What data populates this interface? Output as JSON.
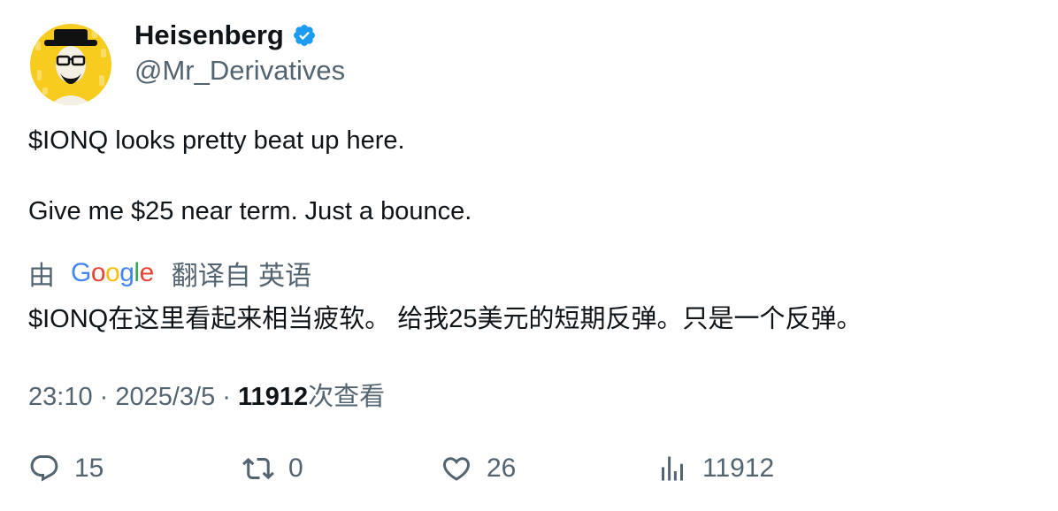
{
  "author": {
    "name": "Heisenberg",
    "handle": "@Mr_Derivatives",
    "verified": true,
    "avatar_icon": "heisenberg-avatar-icon"
  },
  "tweet": {
    "lines": [
      "$IONQ looks pretty beat up here.",
      "Give me $25 near term. Just a bounce."
    ]
  },
  "translation": {
    "prefix": "由",
    "provider_logo": "Google",
    "suffix": "翻译自 英语",
    "text": "$IONQ在这里看起来相当疲软。 给我25美元的短期反弹。只是一个反弹。"
  },
  "meta": {
    "time": "23:10",
    "sep1": " · ",
    "date": "2025/3/5",
    "sep2": " · ",
    "views": "11912",
    "views_label": "次查看"
  },
  "actions": {
    "reply_count": "15",
    "retweet_count": "0",
    "like_count": "26",
    "views_count": "11912"
  },
  "colors": {
    "accent": "#1d9bf0",
    "text": "#0f1419",
    "secondary": "#536471",
    "avatar_bg": "#f7cc1f"
  }
}
